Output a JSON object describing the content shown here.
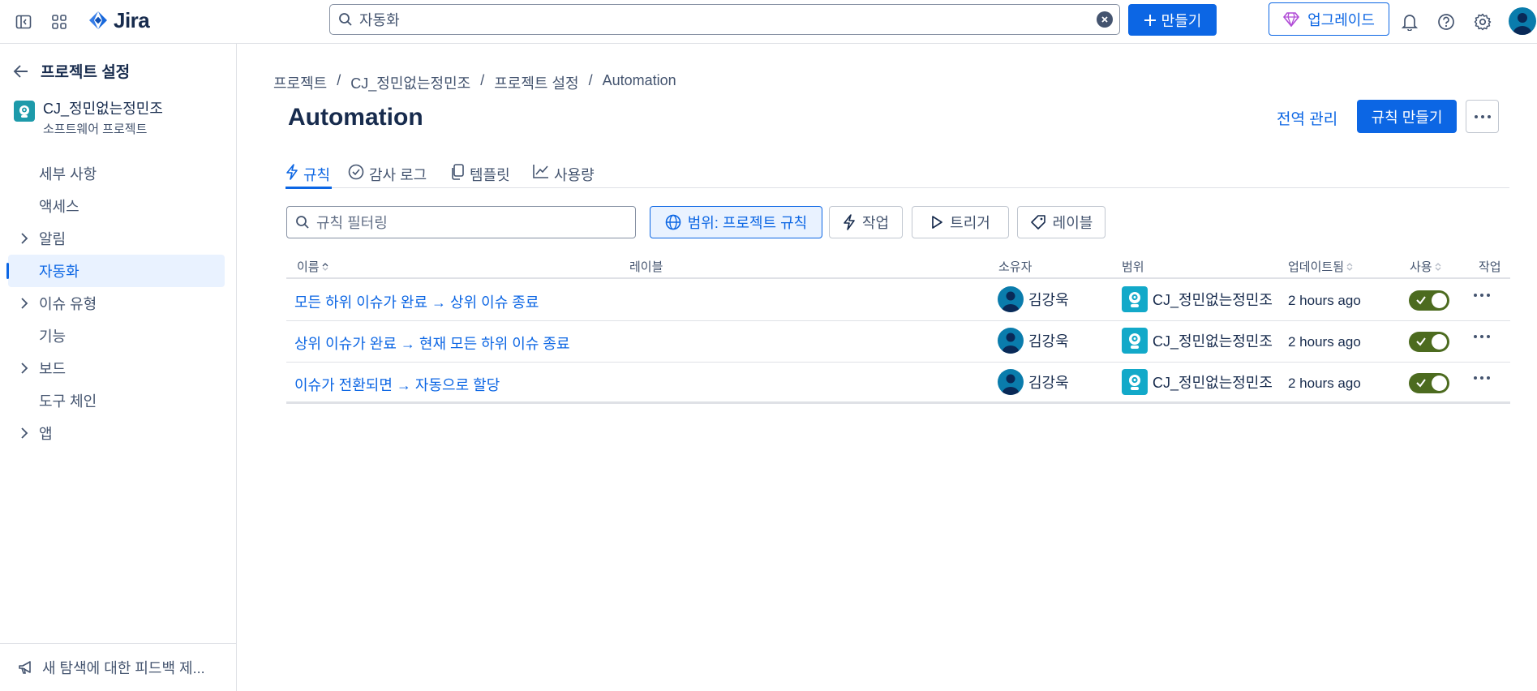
{
  "topbar": {
    "app_name": "Jira",
    "search_value": "자동화",
    "create_label": "만들기",
    "upgrade_label": "업그레이드"
  },
  "sidebar": {
    "back_title": "프로젝트 설정",
    "project_name": "CJ_정민없는정민조",
    "project_type": "소프트웨어 프로젝트",
    "items": [
      {
        "label": "세부 사항",
        "expandable": false
      },
      {
        "label": "액세스",
        "expandable": false
      },
      {
        "label": "알림",
        "expandable": true
      },
      {
        "label": "자동화",
        "expandable": false,
        "active": true
      },
      {
        "label": "이슈 유형",
        "expandable": true
      },
      {
        "label": "기능",
        "expandable": false
      },
      {
        "label": "보드",
        "expandable": true
      },
      {
        "label": "도구 체인",
        "expandable": false
      },
      {
        "label": "앱",
        "expandable": true
      }
    ],
    "feedback": "새 탐색에 대한 피드백 제..."
  },
  "main": {
    "breadcrumb": [
      "프로젝트",
      "/",
      "CJ_정민없는정민조",
      "/",
      "프로젝트 설정",
      "/",
      "Automation"
    ],
    "title": "Automation",
    "manage_link": "전역 관리",
    "create_rule": "규칙 만들기",
    "tabs": [
      {
        "label": "규칙",
        "icon": "lightning-icon",
        "active": true
      },
      {
        "label": "감사 로그",
        "icon": "check-circle-icon"
      },
      {
        "label": "템플릿",
        "icon": "copy-icon"
      },
      {
        "label": "사용량",
        "icon": "line-chart-icon"
      }
    ],
    "filter_placeholder": "규칙 필터링",
    "chips": {
      "scope": "범위: 프로젝트 규칙",
      "action": "작업",
      "trigger": "트리거",
      "label": "레이블"
    },
    "table": {
      "headers": {
        "name": "이름",
        "labels": "레이블",
        "owner": "소유자",
        "scope": "범위",
        "updated": "업데이트됨",
        "enabled": "사용",
        "actions": "작업"
      },
      "rows": [
        {
          "name": "모든 하위 이슈가 완료 → 상위 이슈 종료",
          "owner": "김강욱",
          "scope": "CJ_정민없는정민조",
          "updated": "2 hours ago",
          "enabled": true
        },
        {
          "name": "상위 이슈가 완료 → 현재 모든 하위 이슈 종료",
          "owner": "김강욱",
          "scope": "CJ_정민없는정민조",
          "updated": "2 hours ago",
          "enabled": true
        },
        {
          "name": "이슈가 전환되면 → 자동으로 할당",
          "owner": "김강욱",
          "scope": "CJ_정민없는정민조",
          "updated": "2 hours ago",
          "enabled": true
        }
      ]
    }
  },
  "colors": {
    "brand": "#0c66e4",
    "toggle_on": "#4c6b1f"
  }
}
